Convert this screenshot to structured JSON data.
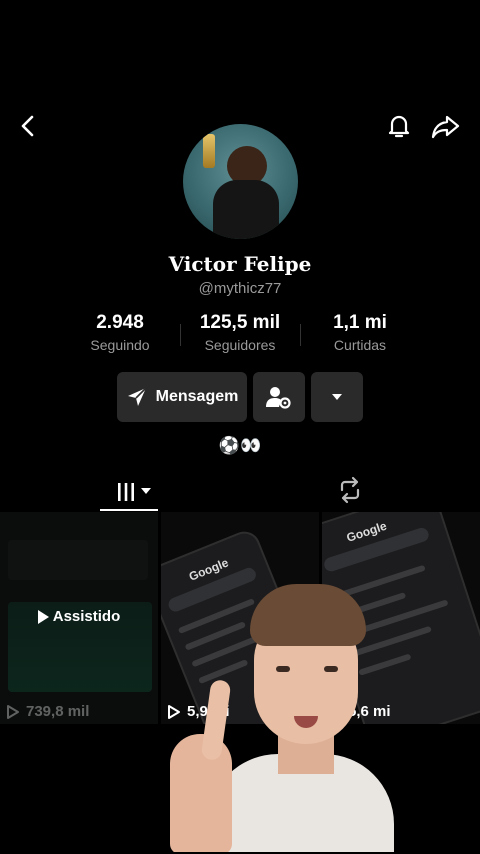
{
  "header": {
    "back_icon": "chevron-left-icon",
    "bell_icon": "bell-icon",
    "share_icon": "share-arrow-icon"
  },
  "profile": {
    "name": "Victor Felipe",
    "handle": "@mythicz77",
    "bio": "⚽👀"
  },
  "stats": [
    {
      "value": "2.948",
      "label": "Seguindo"
    },
    {
      "value": "125,5 mil",
      "label": "Seguidores"
    },
    {
      "value": "1,1 mi",
      "label": "Curtidas"
    }
  ],
  "actions": {
    "message_label": "Mensagem",
    "message_icon": "send-icon",
    "follow_settings_icon": "user-gear-icon",
    "dropdown_icon": "caret-down-icon"
  },
  "tabs": {
    "videos_icon": "grid-lines-icon",
    "repost_icon": "repost-icon"
  },
  "videos": [
    {
      "views": "739,8 mil",
      "badge": "Assistido"
    },
    {
      "views": "5,9 mi",
      "phone_title": "Google"
    },
    {
      "views": "5,6 mi",
      "phone_title": "Google"
    }
  ],
  "colors": {
    "background": "#000000",
    "button": "#2a2a2a",
    "muted_text": "#9a9a9a"
  }
}
